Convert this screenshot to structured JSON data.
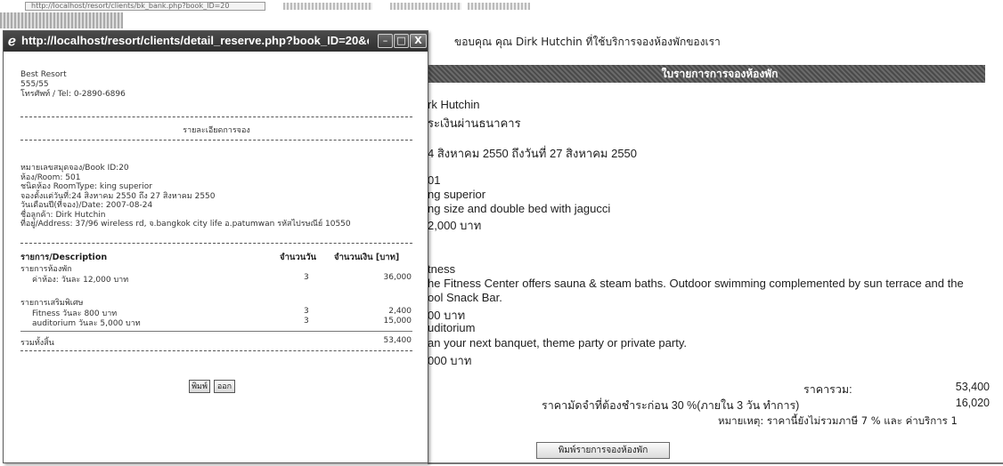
{
  "browser": {
    "address_url": "http://localhost/resort/clients/bk_bank.php?book_ID=20"
  },
  "popup": {
    "title": "http://localhost/resort/clients/detail_reserve.php?book_ID=20&clien...",
    "hotel_name": "Best Resort",
    "hotel_address": "555/55",
    "hotel_phone": "โทรศัพท์ / Tel: 0-2890-6896",
    "section_title": "รายละเอียดการจอง",
    "info_lines": [
      "หมายเลขสมุดจอง/Book ID:20",
      "ห้อง/Room: 501",
      "ชนิดห้อง RoomType: king superior",
      "จองตั้งแต่วันที่:24 สิงหาคม 2550 ถึง 27 สิงหาคม 2550",
      "วันเดือนปี(ที่จอง)/Date: 2007-08-24",
      "ชื่อลูกค้า: Dirk Hutchin",
      "ที่อยู่/Address: 37/96 wireless rd, จ.bangkok city life อ.patumwan รหัสไปรษณีย์ 10550"
    ],
    "table": {
      "headers": [
        "รายการ/Description",
        "จำนวนวัน",
        "จำนวนเงิน [บาท]"
      ],
      "room_group_label": "รายการห้องพัก",
      "room_rows": [
        {
          "desc": "ค่าห้อง: วันละ 12,000 บาท",
          "days": "3",
          "amount": "36,000"
        }
      ],
      "extra_group_label": "รายการเสริมพิเศษ",
      "extra_rows": [
        {
          "desc": "Fitness วันละ 800 บาท",
          "days": "3",
          "amount": "2,400"
        },
        {
          "desc": "auditorium วันละ 5,000 บาท",
          "days": "3",
          "amount": "15,000"
        }
      ],
      "total_label": "รวมทั้งสิ้น",
      "total_amount": "53,400"
    },
    "print_button": "พิมพ์",
    "close_button": "ออก",
    "window_buttons": {
      "minimize": "–",
      "maximize": "□",
      "close": "X"
    }
  },
  "page": {
    "thanks_message": "ขอบคุณ คุณ Dirk Hutchin ที่ใช้บริการจองห้องพักของเรา",
    "section_header": "ใบรายการการจองห้องพัก",
    "detail_lines": [
      "rk Hutchin",
      "ระเงินผ่านธนาคาร",
      "",
      "4 สิงหาคม 2550 ถึงวันที่ 27 สิงหาคม 2550",
      "",
      "01",
      "ng superior",
      "ng size and double bed with jagucci",
      "2,000 บาท",
      "",
      "tness",
      "he Fitness Center offers sauna & steam baths. Outdoor swimming complemented by sun terrace and the",
      "ool Snack Bar.",
      "00 บาท",
      "uditorium",
      "an your next banquet, theme party or private party.",
      "000 บาท"
    ],
    "totals": {
      "total_label": "ราคารวม:",
      "total_value": "53,400",
      "deposit_label": "ราคามัดจำที่ต้องชำระก่อน 30 %(ภายใน 3 วัน ทำการ)",
      "deposit_value": "16,020",
      "note": "หมายเหตุ: ราคานี้ยังไม่รวมภาษี 7 % และ ค่าบริการ 1"
    },
    "print_booking_button": "พิมพ์รายการจองห้องพัก"
  }
}
